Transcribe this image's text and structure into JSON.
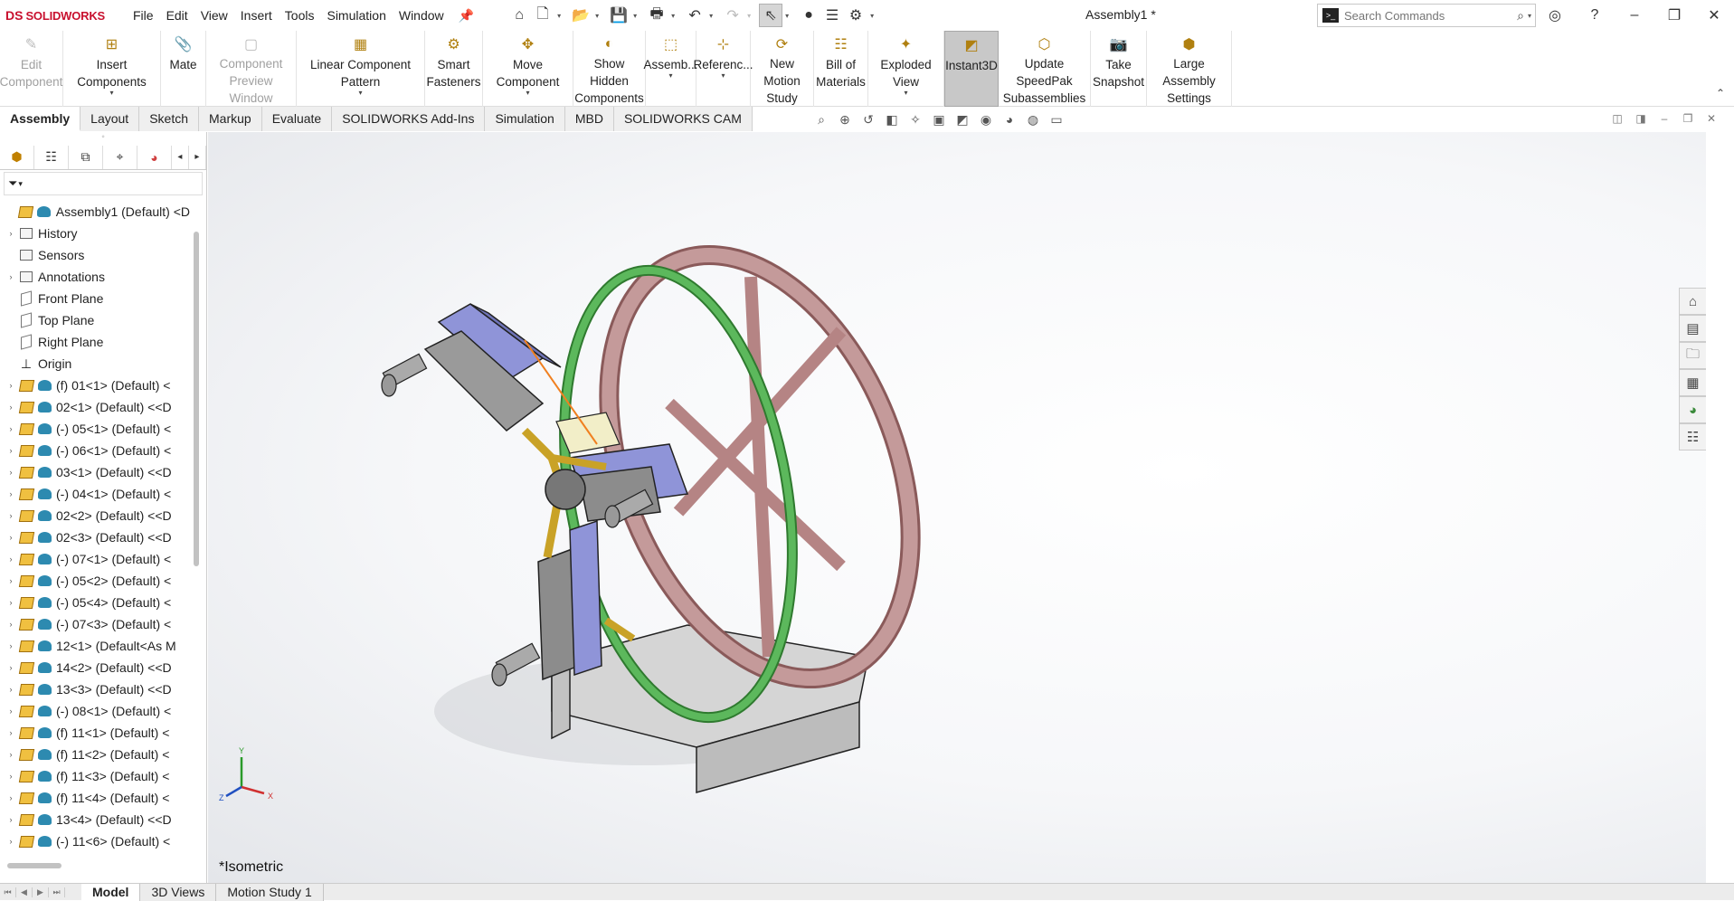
{
  "app": {
    "brand_prefix": "DS",
    "brand": "SOLIDWORKS",
    "document_title": "Assembly1 *"
  },
  "menu": [
    "File",
    "Edit",
    "View",
    "Insert",
    "Tools",
    "Simulation",
    "Window"
  ],
  "search": {
    "placeholder": "Search Commands"
  },
  "ribbon": [
    {
      "label": "Edit\nComponent",
      "icon": "edit-component-icon",
      "disabled": true,
      "dropdown": false
    },
    {
      "label": "Insert Components",
      "icon": "insert-components-icon",
      "disabled": false,
      "dropdown": true
    },
    {
      "label": "Mate",
      "icon": "mate-icon",
      "disabled": false,
      "dropdown": false
    },
    {
      "label": "Component\nPreview Window",
      "icon": "preview-window-icon",
      "disabled": true,
      "dropdown": false
    },
    {
      "label": "Linear Component Pattern",
      "icon": "linear-pattern-icon",
      "disabled": false,
      "dropdown": true
    },
    {
      "label": "Smart\nFasteners",
      "icon": "smart-fasteners-icon",
      "disabled": false,
      "dropdown": false
    },
    {
      "label": "Move Component",
      "icon": "move-component-icon",
      "disabled": false,
      "dropdown": true
    },
    {
      "label": "Show Hidden\nComponents",
      "icon": "show-hidden-icon",
      "disabled": false,
      "dropdown": false
    },
    {
      "label": "Assemb...",
      "icon": "assembly-features-icon",
      "disabled": false,
      "dropdown": true
    },
    {
      "label": "Referenc...",
      "icon": "reference-geometry-icon",
      "disabled": false,
      "dropdown": true
    },
    {
      "label": "New Motion\nStudy",
      "icon": "motion-study-icon",
      "disabled": false,
      "dropdown": false
    },
    {
      "label": "Bill of\nMaterials",
      "icon": "bom-icon",
      "disabled": false,
      "dropdown": false
    },
    {
      "label": "Exploded View",
      "icon": "exploded-view-icon",
      "disabled": false,
      "dropdown": true
    },
    {
      "label": "Instant3D",
      "icon": "instant3d-icon",
      "disabled": false,
      "dropdown": false,
      "active": true
    },
    {
      "label": "Update SpeedPak\nSubassemblies",
      "icon": "speedpak-icon",
      "disabled": false,
      "dropdown": false
    },
    {
      "label": "Take\nSnapshot",
      "icon": "camera-icon",
      "disabled": false,
      "dropdown": false
    },
    {
      "label": "Large Assembly\nSettings",
      "icon": "large-assembly-icon",
      "disabled": false,
      "dropdown": false
    }
  ],
  "tabs": [
    "Assembly",
    "Layout",
    "Sketch",
    "Markup",
    "Evaluate",
    "SOLIDWORKS Add-Ins",
    "Simulation",
    "MBD",
    "SOLIDWORKS CAM"
  ],
  "active_tab": "Assembly",
  "tree": [
    {
      "label": "Assembly1 (Default) <D",
      "type": "root",
      "expand": false
    },
    {
      "label": "History",
      "type": "folder",
      "expand": true
    },
    {
      "label": "Sensors",
      "type": "folder",
      "expand": false
    },
    {
      "label": "Annotations",
      "type": "folder",
      "expand": true
    },
    {
      "label": "Front Plane",
      "type": "plane",
      "expand": false
    },
    {
      "label": "Top Plane",
      "type": "plane",
      "expand": false
    },
    {
      "label": "Right Plane",
      "type": "plane",
      "expand": false
    },
    {
      "label": "Origin",
      "type": "origin",
      "expand": false
    },
    {
      "label": "(f) 01<1> (Default) <",
      "type": "part",
      "expand": true
    },
    {
      "label": "02<1> (Default) <<D",
      "type": "part",
      "expand": true
    },
    {
      "label": "(-) 05<1> (Default) <",
      "type": "part",
      "expand": true
    },
    {
      "label": "(-) 06<1> (Default) <",
      "type": "part",
      "expand": true
    },
    {
      "label": "03<1> (Default) <<D",
      "type": "part",
      "expand": true
    },
    {
      "label": "(-) 04<1> (Default) <",
      "type": "part",
      "expand": true
    },
    {
      "label": "02<2> (Default) <<D",
      "type": "part",
      "expand": true
    },
    {
      "label": "02<3> (Default) <<D",
      "type": "part",
      "expand": true
    },
    {
      "label": "(-) 07<1> (Default) <",
      "type": "part",
      "expand": true
    },
    {
      "label": "(-) 05<2> (Default) <",
      "type": "part",
      "expand": true
    },
    {
      "label": "(-) 05<4> (Default) <",
      "type": "part",
      "expand": true
    },
    {
      "label": "(-) 07<3> (Default) <",
      "type": "part",
      "expand": true
    },
    {
      "label": "12<1> (Default<As M",
      "type": "part",
      "expand": true
    },
    {
      "label": "14<2> (Default) <<D",
      "type": "part",
      "expand": true
    },
    {
      "label": "13<3> (Default) <<D",
      "type": "part",
      "expand": true
    },
    {
      "label": "(-) 08<1> (Default) <",
      "type": "part",
      "expand": true
    },
    {
      "label": "(f) 11<1> (Default) <",
      "type": "part",
      "expand": true
    },
    {
      "label": "(f) 11<2> (Default) <",
      "type": "part",
      "expand": true
    },
    {
      "label": "(f) 11<3> (Default) <",
      "type": "part",
      "expand": true
    },
    {
      "label": "(f) 11<4> (Default) <",
      "type": "part",
      "expand": true
    },
    {
      "label": "13<4> (Default) <<D",
      "type": "part",
      "expand": true
    },
    {
      "label": "(-) 11<6> (Default) <",
      "type": "part",
      "expand": true
    }
  ],
  "viewport": {
    "view_name": "*Isometric",
    "triad": {
      "x": "X",
      "y": "Y",
      "z": "Z"
    }
  },
  "bottom_tabs": [
    "Model",
    "3D Views",
    "Motion Study 1"
  ],
  "active_bottom_tab": "Model",
  "colors": {
    "accent": "#2d8ab0",
    "part_yellow": "#f0c040",
    "wheel": "#c49a9a",
    "ring": "#5cb85c",
    "bracket": "#8f94d8",
    "base": "#d8d8d8",
    "brass": "#c9a227"
  }
}
